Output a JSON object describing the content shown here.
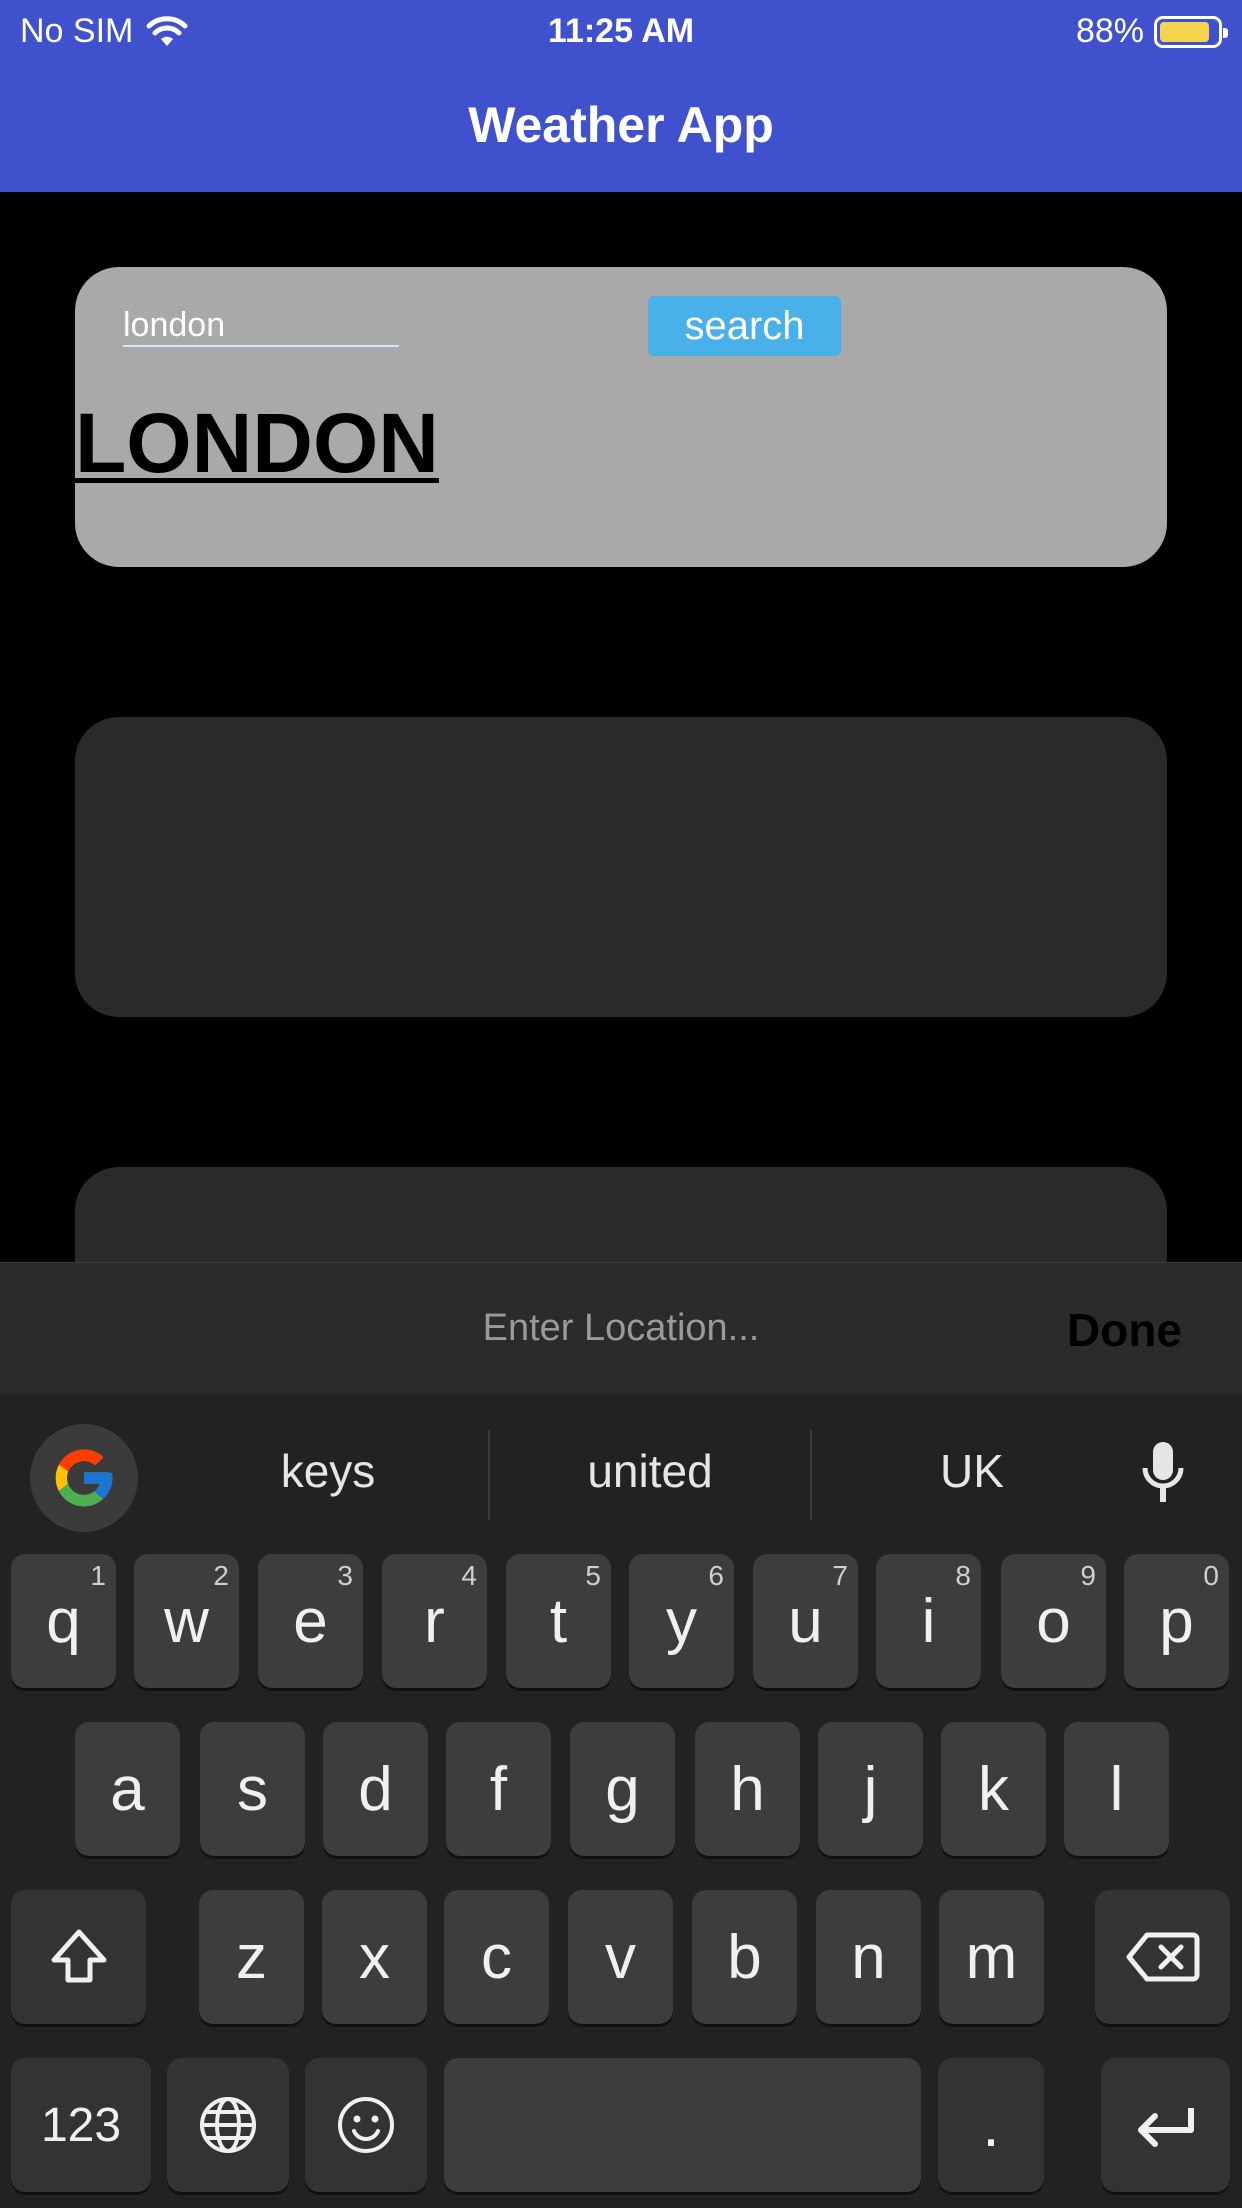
{
  "status_bar": {
    "carrier": "No SIM",
    "time": "11:25 AM",
    "battery": "88%",
    "battery_level": 0.88,
    "battery_color": "#f2d54a"
  },
  "header": {
    "title": "Weather App",
    "background": "#4051cd"
  },
  "search_card": {
    "input_value": "london",
    "button_label": "search",
    "city": "LONDON"
  },
  "accessory_bar": {
    "placeholder": "Enter Location...",
    "done_label": "Done"
  },
  "keyboard": {
    "suggestions": [
      "keys",
      "united",
      "UK"
    ],
    "row1": [
      {
        "key": "q",
        "hint": "1"
      },
      {
        "key": "w",
        "hint": "2"
      },
      {
        "key": "e",
        "hint": "3"
      },
      {
        "key": "r",
        "hint": "4"
      },
      {
        "key": "t",
        "hint": "5"
      },
      {
        "key": "y",
        "hint": "6"
      },
      {
        "key": "u",
        "hint": "7"
      },
      {
        "key": "i",
        "hint": "8"
      },
      {
        "key": "o",
        "hint": "9"
      },
      {
        "key": "p",
        "hint": "0"
      }
    ],
    "row2": [
      "a",
      "s",
      "d",
      "f",
      "g",
      "h",
      "j",
      "k",
      "l"
    ],
    "row3": [
      "z",
      "x",
      "c",
      "v",
      "b",
      "n",
      "m"
    ],
    "numbers_key": "123",
    "period_key": ".",
    "icons": {
      "shift": "shift-icon",
      "backspace": "backspace-icon",
      "globe": "globe-icon",
      "emoji": "emoji-icon",
      "enter": "enter-icon",
      "mic": "mic-icon",
      "google": "google-icon"
    }
  }
}
